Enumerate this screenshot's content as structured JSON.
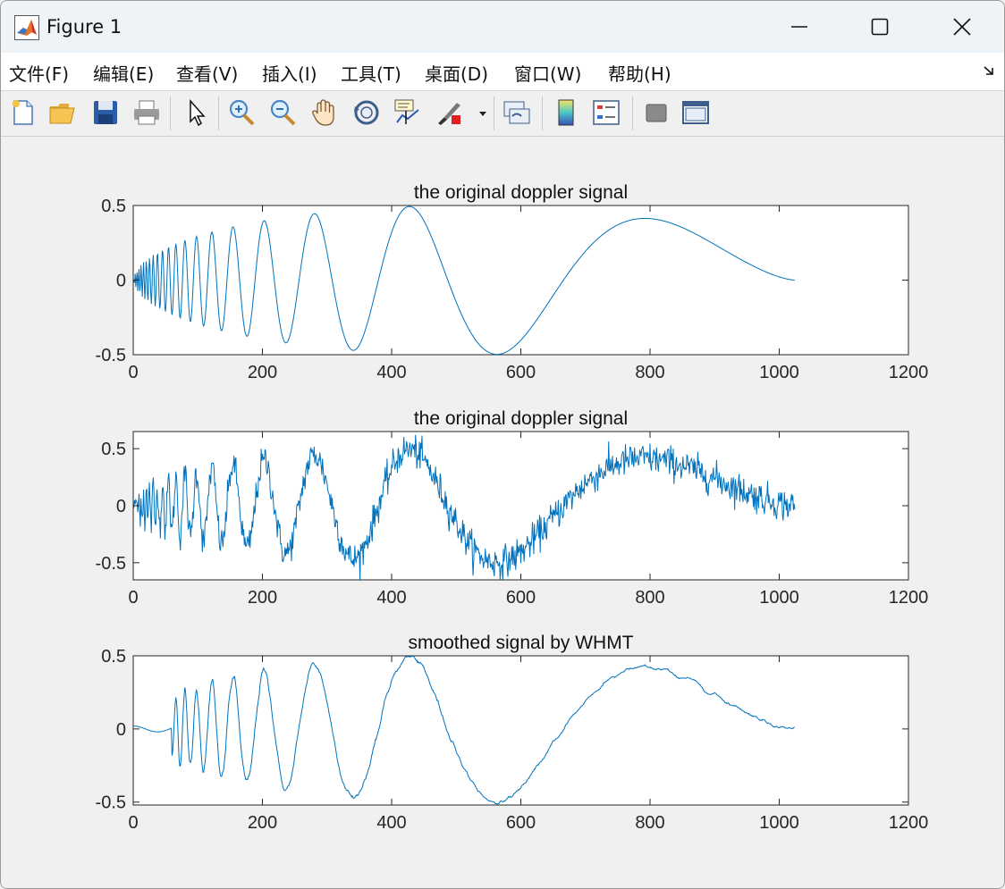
{
  "window": {
    "title": "Figure 1"
  },
  "menu": {
    "items": [
      {
        "label": "文件(F)"
      },
      {
        "label": "编辑(E)"
      },
      {
        "label": "查看(V)"
      },
      {
        "label": "插入(I)"
      },
      {
        "label": "工具(T)"
      },
      {
        "label": "桌面(D)"
      },
      {
        "label": "窗口(W)"
      },
      {
        "label": "帮助(H)"
      }
    ]
  },
  "toolbar": {
    "icons": [
      "new-figure-icon",
      "open-file-icon",
      "save-icon",
      "print-icon",
      "edit-plot-arrow-icon",
      "zoom-in-icon",
      "zoom-out-icon",
      "pan-hand-icon",
      "rotate-3d-icon",
      "data-cursor-icon",
      "brush-icon",
      "link-plot-icon",
      "colorbar-icon",
      "legend-icon",
      "hide-plot-tools-icon",
      "show-plot-tools-icon"
    ]
  },
  "colors": {
    "line": "#0072bd",
    "axes_bg": "#ffffff",
    "figure_bg": "#f0f0f0"
  },
  "chart_data": [
    {
      "type": "line",
      "title": "the original doppler signal",
      "xlabel": "",
      "ylabel": "",
      "xlim": [
        0,
        1200
      ],
      "ylim": [
        -0.5,
        0.5
      ],
      "xticks": [
        0,
        200,
        400,
        600,
        800,
        1000,
        1200
      ],
      "yticks": [
        -0.5,
        0,
        0.5
      ],
      "grid": false,
      "series": [
        {
          "x_range": [
            1,
            1024
          ],
          "peaks": [
            [
              430,
              0.49
            ],
            [
              560,
              -0.5
            ],
            [
              790,
              0.41
            ],
            [
              1024,
              0.0
            ]
          ]
        }
      ]
    },
    {
      "type": "line",
      "title": "the original doppler signal",
      "xlabel": "",
      "ylabel": "",
      "xlim": [
        0,
        1200
      ],
      "ylim": [
        -0.65,
        0.65
      ],
      "xticks": [
        0,
        200,
        400,
        600,
        800,
        1000,
        1200
      ],
      "yticks": [
        -0.5,
        0,
        0.5
      ],
      "grid": false,
      "series": [
        {
          "x_range": [
            1,
            1024
          ],
          "peaks": [
            [
              430,
              0.6
            ],
            [
              560,
              -0.62
            ],
            [
              790,
              0.45
            ],
            [
              1024,
              0.05
            ]
          ]
        }
      ]
    },
    {
      "type": "line",
      "title": "smoothed signal by WHMT",
      "xlabel": "",
      "ylabel": "",
      "xlim": [
        0,
        1200
      ],
      "ylim": [
        -0.52,
        0.5
      ],
      "xticks": [
        0,
        200,
        400,
        600,
        800,
        1000,
        1200
      ],
      "yticks": [
        -0.5,
        0,
        0.5
      ],
      "grid": false,
      "series": [
        {
          "x_range": [
            1,
            1024
          ],
          "peaks": [
            [
              420,
              0.5
            ],
            [
              575,
              -0.52
            ],
            [
              790,
              0.41
            ],
            [
              1024,
              0.03
            ]
          ]
        }
      ]
    }
  ]
}
